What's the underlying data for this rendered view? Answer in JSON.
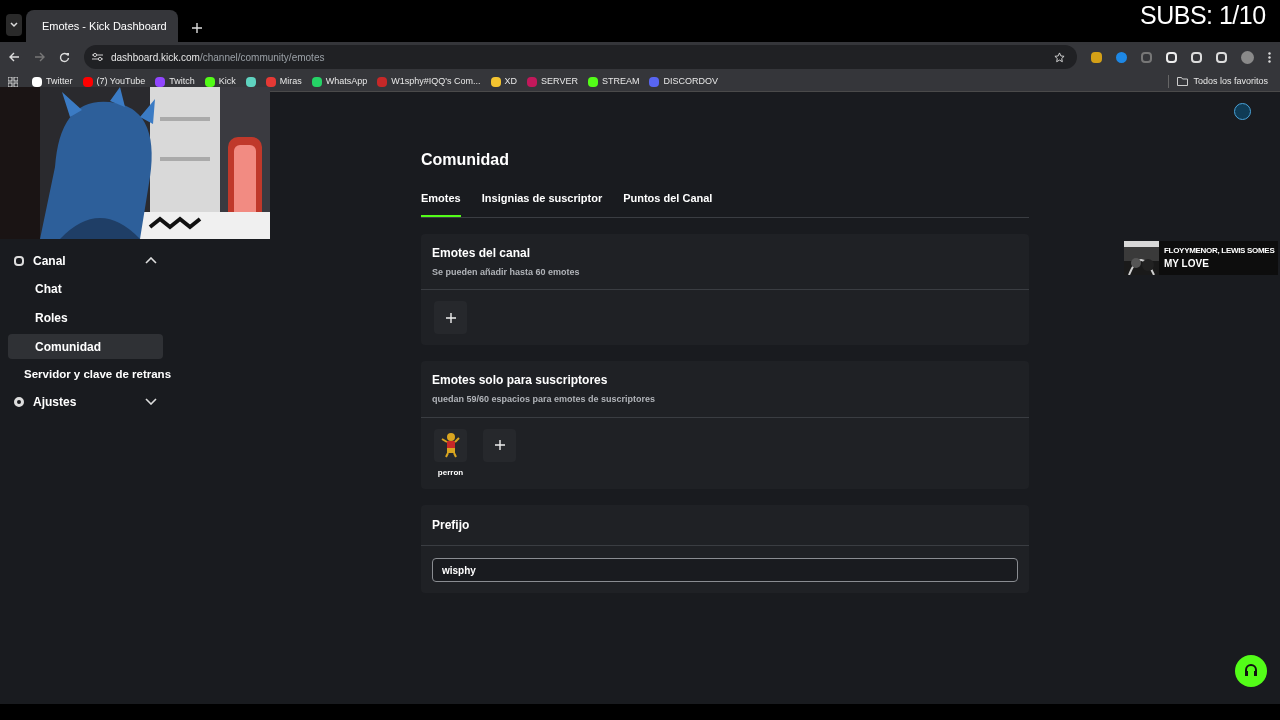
{
  "browser": {
    "tabs": [
      {
        "title": "Emotes - Kick Dashboard",
        "selected": true
      }
    ],
    "url": {
      "host": "dashboard.kick.com",
      "path": "/channel/community/emotes"
    },
    "bookmarks": [
      {
        "kind": "link",
        "label": "Twitter"
      },
      {
        "kind": "link",
        "label": "(7) YouTube"
      },
      {
        "kind": "link",
        "label": "Twitch"
      },
      {
        "kind": "link",
        "label": "Kick"
      },
      {
        "kind": "icon"
      },
      {
        "kind": "link",
        "label": "Miras"
      },
      {
        "kind": "link",
        "label": "WhatsApp"
      },
      {
        "kind": "link",
        "label": "W1sphy#IQQ's Com..."
      },
      {
        "kind": "link",
        "label": "XD"
      },
      {
        "kind": "link",
        "label": "SERVER"
      },
      {
        "kind": "link",
        "label": "STREAM"
      },
      {
        "kind": "link",
        "label": "DISCORDOV"
      }
    ],
    "bookmarks_folder": "Todos los favoritos"
  },
  "stream_overlay": {
    "subs": "SUBS: 1/10",
    "now_playing": {
      "artist": "FLOYYMENOR, LEWIS SOMES",
      "title": "MY LOVE"
    }
  },
  "sidebar": {
    "items": [
      {
        "label": "Canal",
        "kind": "group",
        "expanded": true,
        "selected": false,
        "children": [
          {
            "label": "Chat",
            "selected": false
          },
          {
            "label": "Roles",
            "selected": false
          },
          {
            "label": "Comunidad",
            "selected": true
          }
        ]
      },
      {
        "label": "Servidor y clave de retrans",
        "kind": "link",
        "selected": false
      },
      {
        "label": "Ajustes",
        "kind": "group",
        "expanded": false,
        "selected": false
      }
    ]
  },
  "page": {
    "title": "Comunidad",
    "tabs": [
      {
        "label": "Emotes",
        "selected": true
      },
      {
        "label": "Insignias de suscriptor",
        "selected": false
      },
      {
        "label": "Puntos del Canal",
        "selected": false
      }
    ],
    "sections": [
      {
        "title": "Emotes del canal",
        "subtitle": "Se pueden añadir hasta 60 emotes"
      },
      {
        "title": "Emotes solo para suscriptores",
        "subtitle": "quedan 59/60 espacios para emotes de suscriptores",
        "emotes": [
          {
            "name": "perron"
          }
        ]
      }
    ],
    "prefix": {
      "title": "Prefijo",
      "value": "wisphy"
    }
  }
}
